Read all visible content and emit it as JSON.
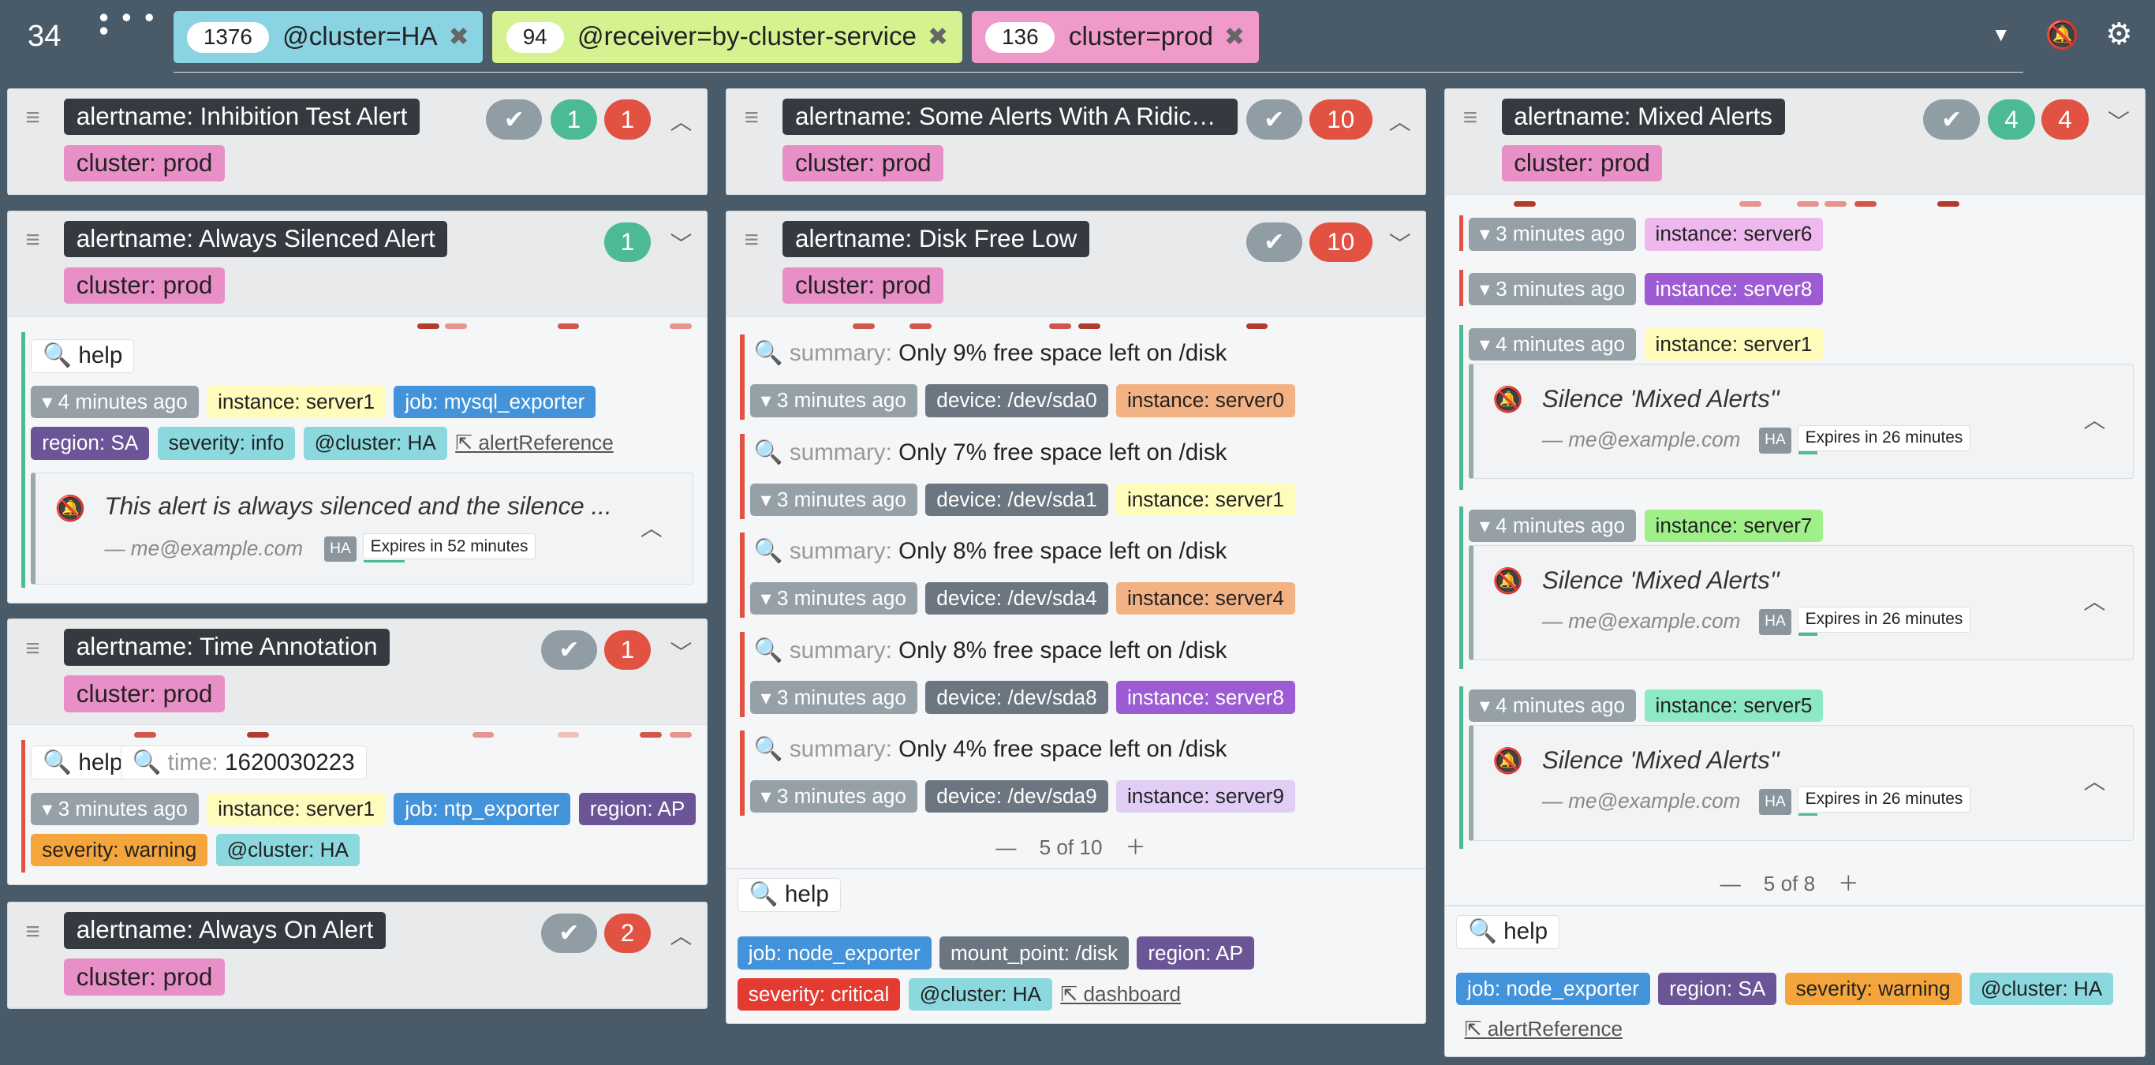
{
  "top": {
    "count": "34"
  },
  "filters": [
    {
      "count": "1376",
      "label": "@cluster=HA",
      "bg": "#8ad3e3"
    },
    {
      "count": "94",
      "label": "@receiver=by-cluster-service",
      "bg": "#d5f291"
    },
    {
      "count": "136",
      "label": "cluster=prod",
      "bg": "#ef9ac9"
    }
  ],
  "groups": {
    "inhibition": {
      "name": "alertname: Inhibition Test Alert",
      "cluster": "cluster: prod",
      "green": "1",
      "red": "1"
    },
    "silenced": {
      "name": "alertname: Always Silenced Alert",
      "cluster": "cluster: prod",
      "green": "1",
      "help": "help",
      "ts": "4 minutes ago",
      "instance": "instance: server1",
      "job": "job: mysql_exporter",
      "region": "region: SA",
      "severity": "severity: info",
      "hacluster": "@cluster: HA",
      "link": "alertReference",
      "silence": "This alert is always silenced and the silence ...",
      "by": "— me@example.com",
      "ha": "HA",
      "expires": "Expires in 52 minutes"
    },
    "time": {
      "name": "alertname: Time Annotation",
      "cluster": "cluster: prod",
      "red": "1",
      "help": "help",
      "timekey": "time:",
      "timeval": "1620030223",
      "ts": "3 minutes ago",
      "instance": "instance: server1",
      "job": "job: ntp_exporter",
      "region": "region: AP",
      "severity": "severity: warning",
      "hacluster": "@cluster: HA"
    },
    "on": {
      "name": "alertname: Always On Alert",
      "cluster": "cluster: prod",
      "red": "2"
    },
    "ridiculous": {
      "name": "alertname: Some Alerts With A Ridicu...",
      "cluster": "cluster: prod",
      "red": "10"
    },
    "disk": {
      "name": "alertname: Disk Free Low",
      "cluster": "cluster: prod",
      "red": "10",
      "alerts": [
        {
          "sk": "summary:",
          "sv": "Only 9% free space left on /disk",
          "ts": "3 minutes ago",
          "dev": "device: /dev/sda0",
          "inst": "instance: server0",
          "ic": "o"
        },
        {
          "sk": "summary:",
          "sv": "Only 7% free space left on /disk",
          "ts": "3 minutes ago",
          "dev": "device: /dev/sda1",
          "inst": "instance: server1",
          "ic": "y"
        },
        {
          "sk": "summary:",
          "sv": "Only 8% free space left on /disk",
          "ts": "3 minutes ago",
          "dev": "device: /dev/sda4",
          "inst": "instance: server4",
          "ic": "o"
        },
        {
          "sk": "summary:",
          "sv": "Only 8% free space left on /disk",
          "ts": "3 minutes ago",
          "dev": "device: /dev/sda8",
          "inst": "instance: server8",
          "ic": "p"
        },
        {
          "sk": "summary:",
          "sv": "Only 4% free space left on /disk",
          "ts": "3 minutes ago",
          "dev": "device: /dev/sda9",
          "inst": "instance: server9",
          "ic": "lav"
        }
      ],
      "pager": "5 of 10",
      "help": "help",
      "job": "job: node_exporter",
      "mount": "mount_point: /disk",
      "region": "region: AP",
      "severity": "severity: critical",
      "hacluster": "@cluster: HA",
      "link": "dashboard"
    },
    "mixed": {
      "name": "alertname: Mixed Alerts",
      "cluster": "cluster: prod",
      "green": "4",
      "red": "4",
      "rows": [
        {
          "ts": "3 minutes ago",
          "inst": "instance: server6",
          "ic": "pk"
        },
        {
          "ts": "3 minutes ago",
          "inst": "instance: server8",
          "ic": "p"
        },
        {
          "ts": "4 minutes ago",
          "inst": "instance: server1",
          "ic": "y"
        },
        {
          "ts": "4 minutes ago",
          "inst": "instance: server7",
          "ic": "g"
        },
        {
          "ts": "4 minutes ago",
          "inst": "instance: server5",
          "ic": "t"
        }
      ],
      "silence": "Silence 'Mixed Alerts''",
      "by": "— me@example.com",
      "ha": "HA",
      "expires": "Expires in 26 minutes",
      "pager": "5 of 8",
      "help": "help",
      "job": "job: node_exporter",
      "region": "region: SA",
      "severity": "severity: warning",
      "hacluster": "@cluster: HA",
      "link": "alertReference"
    }
  }
}
